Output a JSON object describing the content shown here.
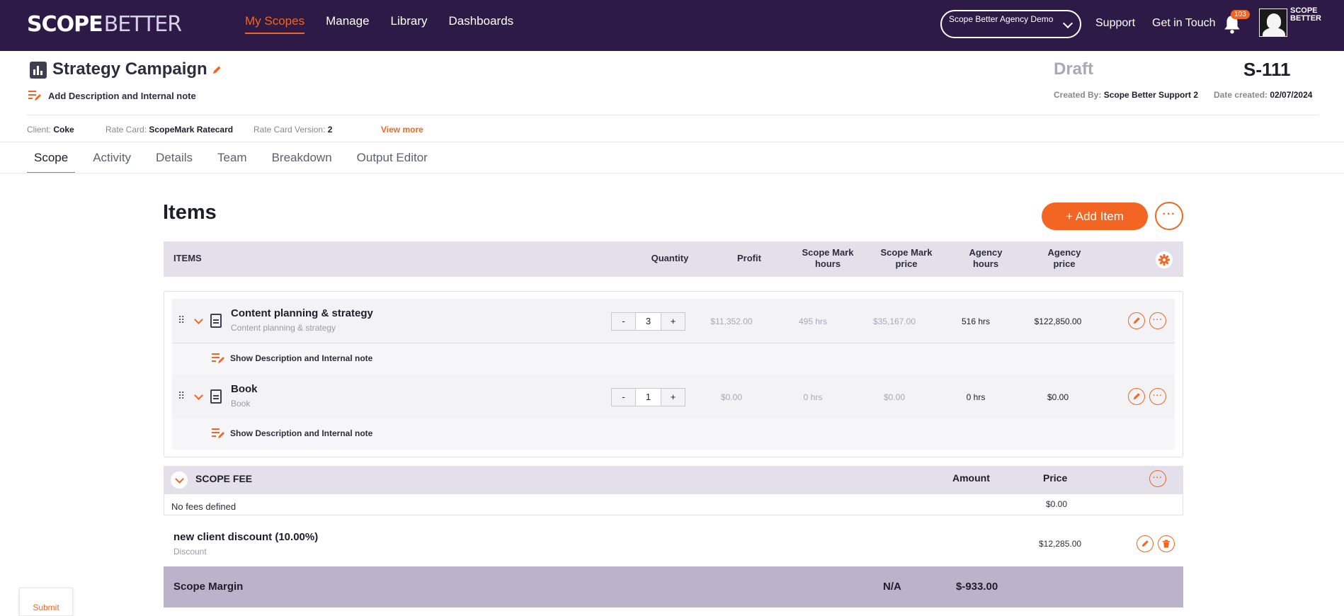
{
  "nav": {
    "logo_part1": "SCOPE",
    "logo_part2": "BETTER",
    "links": [
      "My Scopes",
      "Manage",
      "Library",
      "Dashboards"
    ],
    "agency_select": "Scope Better Agency Demo",
    "support": "Support",
    "get_in_touch": "Get in Touch",
    "notification_count": "103",
    "mini_logo_1": "SCOPE",
    "mini_logo_2": "BETTER"
  },
  "scope": {
    "title": "Strategy Campaign",
    "status": "Draft",
    "id": "S-111",
    "desc_link": "Add Description and Internal note",
    "created_by_label": "Created By:",
    "created_by": "Scope Better Support 2",
    "date_label": "Date created:",
    "date": "02/07/2024",
    "client_label": "Client:",
    "client": "Coke",
    "rate_card_label": "Rate Card:",
    "rate_card": "ScopeMark Ratecard",
    "rate_version_label": "Rate Card Version:",
    "rate_version": "2",
    "view_more": "View more"
  },
  "tabs": [
    "Scope",
    "Activity",
    "Details",
    "Team",
    "Breakdown",
    "Output Editor"
  ],
  "items_section": {
    "title": "Items",
    "add_button": "+ Add Item",
    "more": "···",
    "headers": {
      "items": "ITEMS",
      "quantity": "Quantity",
      "profit": "Profit",
      "sm_hours_1": "Scope Mark",
      "sm_hours_2": "hours",
      "sm_price_1": "Scope Mark",
      "sm_price_2": "price",
      "ag_hours_1": "Agency",
      "ag_hours_2": "hours",
      "ag_price_1": "Agency",
      "ag_price_2": "price"
    },
    "rows": [
      {
        "name": "Content planning & strategy",
        "subtitle": "Content planning & strategy",
        "qty": "3",
        "profit": "$11,352.00",
        "sm_hours": "495 hrs",
        "sm_price": "$35,167.00",
        "ag_hours": "516 hrs",
        "ag_price": "$122,850.00",
        "show_desc": "Show Description and Internal note"
      },
      {
        "name": "Book",
        "subtitle": "Book",
        "qty": "1",
        "profit": "$0.00",
        "sm_hours": "0 hrs",
        "sm_price": "$0.00",
        "ag_hours": "0 hrs",
        "ag_price": "$0.00",
        "show_desc": "Show Description and Internal note"
      }
    ],
    "minus": "-",
    "plus": "+"
  },
  "scope_fee": {
    "title": "SCOPE FEE",
    "amount_label": "Amount",
    "price_label": "Price",
    "empty": "No fees defined",
    "price": "$0.00"
  },
  "discount": {
    "name": "new client discount (10.00%)",
    "type": "Discount",
    "value": "$12,285.00"
  },
  "margin": {
    "label": "Scope Margin",
    "na": "N/A",
    "value": "$-933.00"
  },
  "submit": "Submit",
  "colors": {
    "brand_dark": "#2e1a47",
    "accent": "#f26522",
    "header_band": "#e3e0eb",
    "margin_band": "#bcb3ca"
  }
}
